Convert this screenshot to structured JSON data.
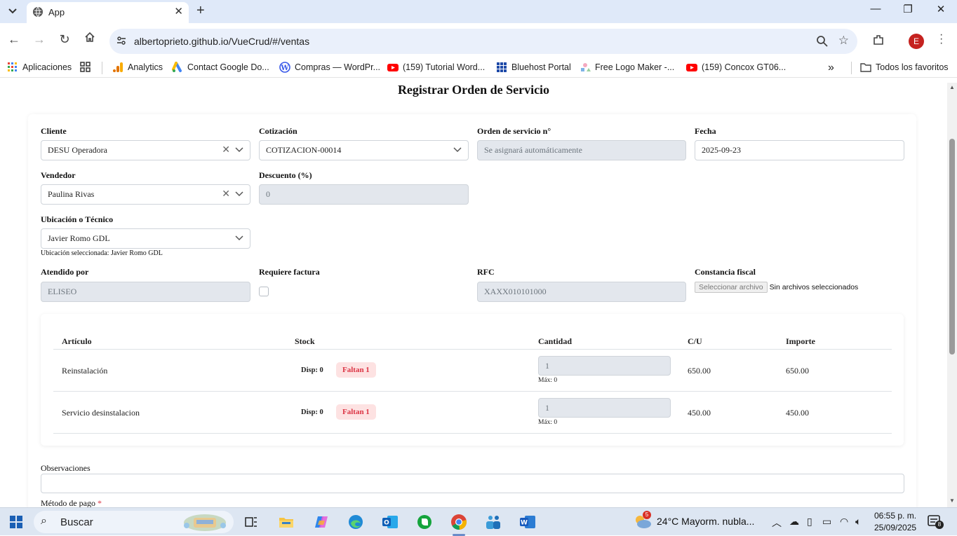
{
  "browser": {
    "tab_title": "App",
    "url": "albertoprieto.github.io/VueCrud/#/ventas",
    "avatar_letter": "E",
    "bookmarks": [
      {
        "label": "Aplicaciones",
        "icon": "apps-grid-icon"
      },
      {
        "label": "",
        "icon": "grid-icon"
      },
      {
        "label": "Analytics",
        "icon": "analytics-icon"
      },
      {
        "label": "Contact Google Do...",
        "icon": "google-ads-icon"
      },
      {
        "label": "Compras — WordPr...",
        "icon": "wordpress-icon"
      },
      {
        "label": "(159) Tutorial Word...",
        "icon": "youtube-icon"
      },
      {
        "label": "Bluehost Portal",
        "icon": "bluehost-icon"
      },
      {
        "label": "Free Logo Maker -...",
        "icon": "logo-maker-icon"
      },
      {
        "label": "(159) Concox GT06...",
        "icon": "youtube-icon"
      }
    ],
    "all_bookmarks": "Todos los favoritos"
  },
  "page": {
    "title": "Registrar Orden de Servicio",
    "form": {
      "cliente": {
        "label": "Cliente",
        "value": "DESU Operadora"
      },
      "cotizacion": {
        "label": "Cotización",
        "value": "COTIZACION-00014"
      },
      "orden": {
        "label": "Orden de servicio n°",
        "value": "Se asignará automáticamente"
      },
      "fecha": {
        "label": "Fecha",
        "value": "2025-09-23"
      },
      "vendedor": {
        "label": "Vendedor",
        "value": "Paulina Rivas"
      },
      "descuento": {
        "label": "Descuento (%)",
        "value": "0"
      },
      "ubicacion": {
        "label": "Ubicación o Técnico",
        "value": "Javier Romo GDL",
        "hint": "Ubicación seleccionada: Javier Romo GDL"
      },
      "atendido": {
        "label": "Atendido por",
        "value": "ELISEO"
      },
      "factura": {
        "label": "Requiere factura",
        "checked": false
      },
      "rfc": {
        "label": "RFC",
        "value": "XAXX010101000"
      },
      "constancia": {
        "label": "Constancia fiscal",
        "button": "Seleccionar archivo",
        "status": "Sin archivos seleccionados"
      }
    },
    "table": {
      "headers": [
        "Artículo",
        "Stock",
        "Cantidad",
        "C/U",
        "Importe"
      ],
      "rows": [
        {
          "articulo": "Reinstalación",
          "disp": "Disp: 0",
          "faltan": "Faltan 1",
          "cantidad": "1",
          "max": "Máx: 0",
          "cu": "650.00",
          "importe": "650.00"
        },
        {
          "articulo": "Servicio desinstalacion",
          "disp": "Disp: 0",
          "faltan": "Faltan 1",
          "cantidad": "1",
          "max": "Máx: 0",
          "cu": "450.00",
          "importe": "450.00"
        }
      ]
    },
    "observaciones": {
      "label": "Observaciones",
      "value": ""
    },
    "metodo_pago": {
      "label": "Método de pago",
      "required": "*"
    }
  },
  "taskbar": {
    "search": "Buscar",
    "weather_badge": "5",
    "weather": "24°C  Mayorm. nubla...",
    "time": "06:55 p. m.",
    "date": "25/09/2025",
    "notif_count": "8"
  },
  "colors": {
    "tabbar": "#dfe9f9",
    "disabled_field": "#e3e7ed",
    "badge_bg": "#fde2e2",
    "badge_text": "#dc3545",
    "avatar": "#c5221f"
  }
}
